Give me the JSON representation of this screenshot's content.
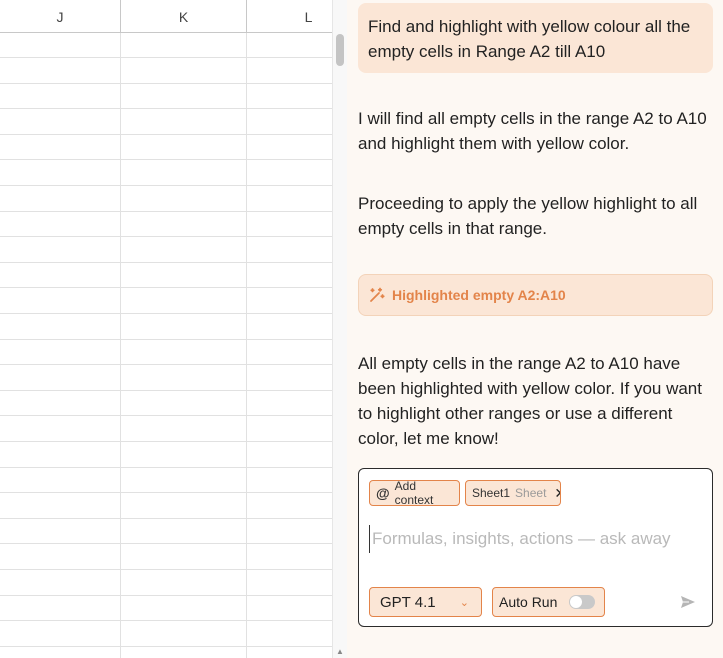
{
  "sheet": {
    "columns": [
      "J",
      "K",
      "L"
    ],
    "row_count": 25
  },
  "chat": {
    "user_message": "Find and highlight with yellow colour all the empty cells in Range A2 till A10",
    "assistant_messages": [
      "I will find all empty cells in the range A2 to A10 and highlight them with yellow color.",
      "Proceeding to apply the yellow highlight to all empty cells in that range."
    ],
    "tool_result": "Highlighted empty A2:A10",
    "final_message": "All empty cells in the range A2 to A10 have been highlighted with yellow color. If you want to highlight other ranges or use a different color, let me know!"
  },
  "composer": {
    "add_context_label": "Add context",
    "context_chip": {
      "name": "Sheet1",
      "type": "Sheet"
    },
    "placeholder": "Formulas, insights, actions — ask away",
    "model": "GPT 4.1",
    "auto_run_label": "Auto Run",
    "auto_run_enabled": false
  },
  "colors": {
    "accent": "#e3844a",
    "bubble": "#fbe6d6",
    "panel_bg": "#fdf8f3"
  }
}
